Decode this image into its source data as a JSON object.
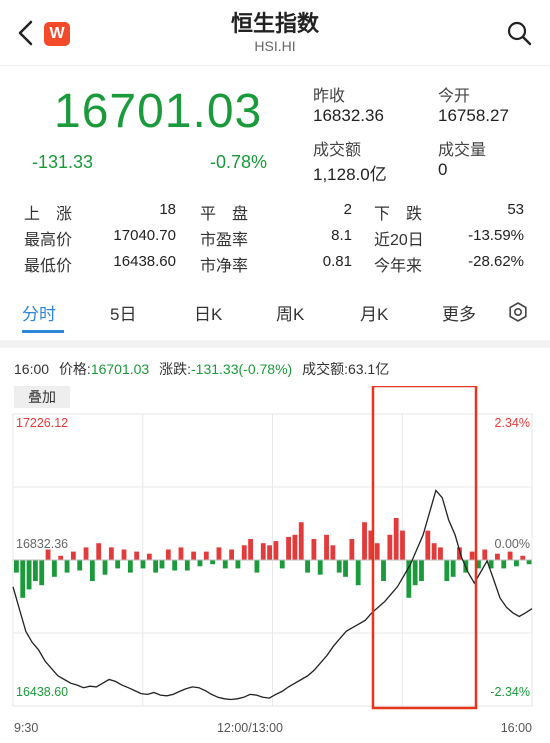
{
  "header": {
    "title": "恒生指数",
    "subtitle": "HSI.HI",
    "app_logo": "W",
    "back_icon": "chevron-left-icon",
    "search_icon": "search-icon"
  },
  "quote": {
    "price": "16701.03",
    "change": "-131.33",
    "change_pct": "-0.78%",
    "prev_close_label": "昨收",
    "prev_close": "16832.36",
    "open_label": "今开",
    "open": "16758.27",
    "turnover_label": "成交额",
    "turnover": "1,128.0亿",
    "volume_label": "成交量",
    "volume": "0"
  },
  "stats": {
    "up_label": "上　涨",
    "up": "18",
    "flat_label": "平　盘",
    "flat": "2",
    "down_label": "下　跌",
    "down": "53",
    "high_label": "最高价",
    "high": "17040.70",
    "pe_label": "市盈率",
    "pe": "8.1",
    "d20_label": "近20日",
    "d20": "-13.59%",
    "low_label": "最低价",
    "low": "16438.60",
    "pb_label": "市净率",
    "pb": "0.81",
    "ytd_label": "今年来",
    "ytd": "-28.62%"
  },
  "tabs": {
    "items": [
      "分时",
      "5日",
      "日K",
      "周K",
      "月K",
      "更多"
    ],
    "active": 0,
    "settings_icon": "gear-icon"
  },
  "chart_info": {
    "time": "16:00",
    "price_label": "价格:",
    "price": "16701.03",
    "change_label": "涨跌:",
    "change": "-131.33(-0.78%)",
    "turnover_label": "成交额:",
    "turnover": "63.1亿",
    "overlay_button": "叠加"
  },
  "colors": {
    "up": "#e23b3b",
    "down": "#1a9a3a",
    "accent": "#2e86d6",
    "highlight_box": "#e5351c"
  },
  "chart_data": {
    "type": "line",
    "x_tick_labels": [
      "9:30",
      "12:00/13:00",
      "16:00"
    ],
    "y_left_labels": [
      "17226.12",
      "16832.36",
      "16438.60"
    ],
    "y_right_labels": [
      "2.34%",
      "0.00%",
      "-2.34%"
    ],
    "prev_close": 16832.36,
    "ylim": [
      16438.6,
      17226.12
    ],
    "price_series": [
      16760,
      16700,
      16640,
      16610,
      16590,
      16560,
      16540,
      16520,
      16510,
      16500,
      16495,
      16488,
      16492,
      16490,
      16500,
      16510,
      16505,
      16495,
      16488,
      16480,
      16472,
      16470,
      16475,
      16468,
      16466,
      16470,
      16478,
      16485,
      16490,
      16488,
      16480,
      16470,
      16462,
      16458,
      16456,
      16458,
      16462,
      16470,
      16468,
      16462,
      16460,
      16470,
      16478,
      16490,
      16500,
      16510,
      16520,
      16535,
      16555,
      16575,
      16600,
      16620,
      16640,
      16650,
      16660,
      16670,
      16690,
      16705,
      16720,
      16740,
      16760,
      16790,
      16820,
      16860,
      16900,
      16960,
      17020,
      17000,
      16940,
      16900,
      16840,
      16800,
      16770,
      16800,
      16830,
      16780,
      16730,
      16705,
      16690,
      16680,
      16690,
      16701
    ],
    "volume_bars": [
      -0.3,
      -0.9,
      -0.7,
      -0.5,
      -0.6,
      0.25,
      -0.4,
      0.1,
      -0.3,
      0.2,
      -0.25,
      0.3,
      -0.5,
      0.4,
      -0.35,
      0.3,
      -0.2,
      0.25,
      -0.3,
      0.2,
      -0.2,
      0.15,
      -0.3,
      -0.2,
      0.25,
      -0.25,
      0.3,
      -0.25,
      0.2,
      -0.15,
      0.2,
      -0.1,
      0.3,
      -0.2,
      0.25,
      -0.2,
      0.35,
      0.5,
      -0.3,
      0.4,
      0.35,
      0.45,
      -0.2,
      0.55,
      0.6,
      0.9,
      -0.3,
      0.5,
      -0.35,
      0.6,
      0.35,
      -0.3,
      -0.4,
      0.5,
      -0.6,
      0.9,
      0.7,
      0.4,
      -0.5,
      0.6,
      1.0,
      0.7,
      -0.9,
      -0.6,
      -0.5,
      0.7,
      0.4,
      0.3,
      -0.5,
      -0.4,
      0.3,
      -0.3,
      0.2,
      -0.2,
      0.25,
      -0.2,
      0.15,
      -0.2,
      0.2,
      -0.15,
      0.1,
      -0.1
    ]
  }
}
